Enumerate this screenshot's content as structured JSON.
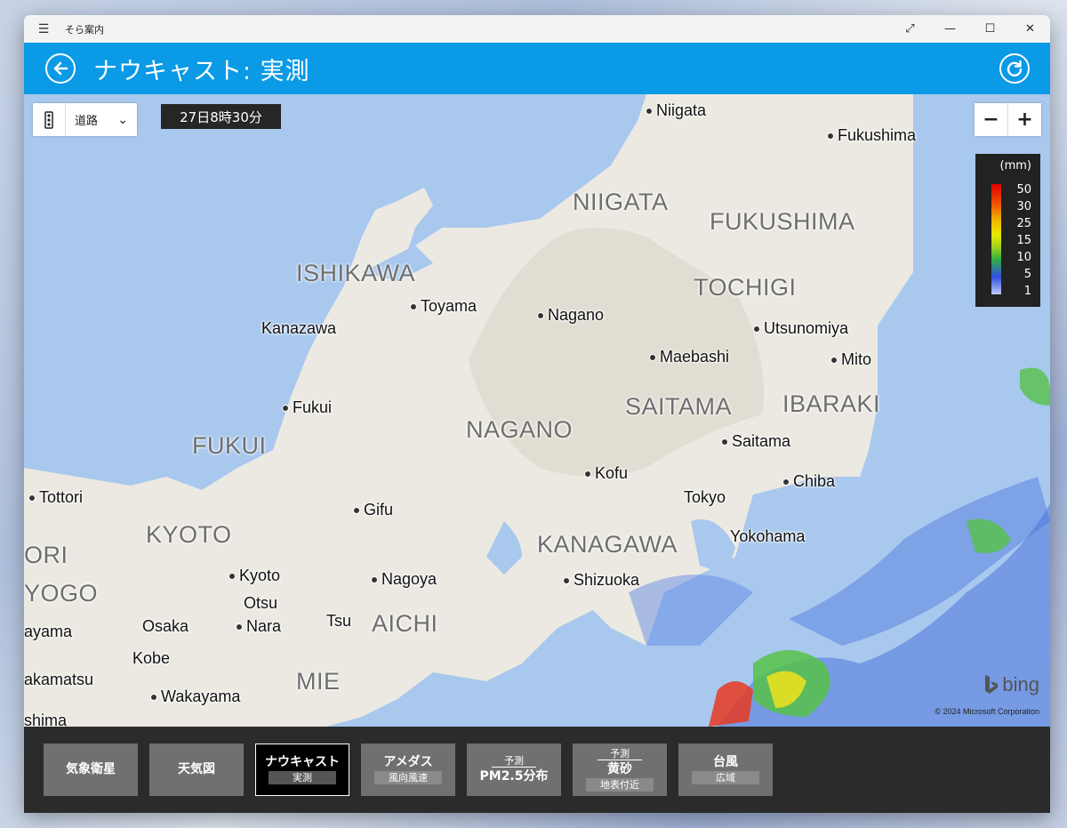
{
  "titlebar": {
    "menu_icon": "hamburger-icon",
    "title": "そら案内"
  },
  "header": {
    "title": "ナウキャスト: 実測"
  },
  "map": {
    "style_select": {
      "label": "道路"
    },
    "time": "27日8時30分",
    "zoom": {
      "minus": "−",
      "plus": "+"
    },
    "cities": [
      "Niigata",
      "Fukushima",
      "Toyama",
      "Kanazawa",
      "Nagano",
      "Utsunomiya",
      "Maebashi",
      "Mito",
      "Fukui",
      "Saitama",
      "Kofu",
      "Chiba",
      "Tottori",
      "Gifu",
      "Tokyo",
      "Yokohama",
      "Kyoto",
      "Otsu",
      "Nagoya",
      "Shizuoka",
      "Osaka",
      "Nara",
      "Tsu",
      "Kobe",
      "Wakayama",
      "ayama",
      "akamatsu",
      "shima"
    ],
    "prefectures": [
      "NIIGATA",
      "FUKUSHIMA",
      "ISHIKAWA",
      "TOCHIGI",
      "SAITAMA",
      "IBARAKI",
      "NAGANO",
      "FUKUI",
      "KYOTO",
      "KANAGAWA",
      "ORI",
      "YOGO",
      "AICHI",
      "MIE"
    ],
    "legend": {
      "unit": "(mm)",
      "levels": [
        "50",
        "30",
        "25",
        "15",
        "10",
        "5",
        "1"
      ]
    },
    "brand": "bing",
    "copyright": "© 2024 Microsoft Corporation"
  },
  "tabs": [
    {
      "main": "気象衛星"
    },
    {
      "main": "天気図"
    },
    {
      "main": "ナウキャスト",
      "sub": "実測",
      "active": true
    },
    {
      "main": "アメダス",
      "sub": "風向風速"
    },
    {
      "top": "予測",
      "main": "PM2.5分布"
    },
    {
      "top": "予測",
      "main": "黄砂",
      "sub": "地表付近"
    },
    {
      "main": "台風",
      "sub": "広域"
    }
  ],
  "colors": {
    "accent": "#0a9ae6",
    "tab_bg": "#707070",
    "active_tab_bg": "#000000"
  }
}
